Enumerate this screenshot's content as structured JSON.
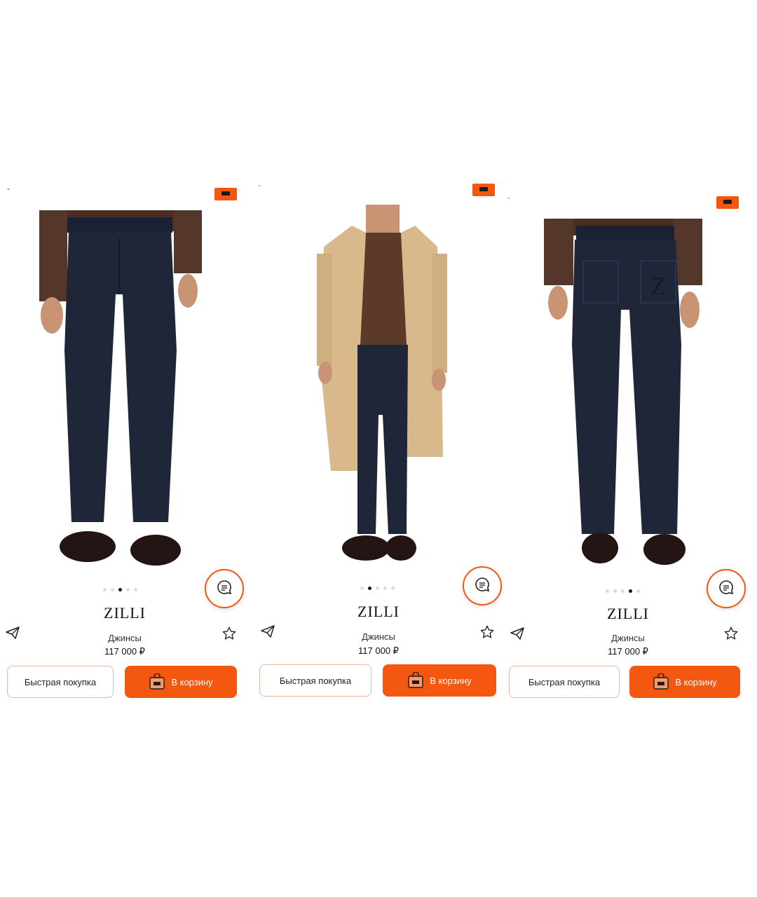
{
  "colors": {
    "accent": "#f4570f",
    "pants": "#1f2638",
    "coat": "#d9b98c",
    "sweater": "#5b3a2a"
  },
  "icons": [
    "chat-icon",
    "share-icon",
    "star-icon",
    "bag-icon"
  ],
  "panels": [
    {
      "brand": "ZILLI",
      "type": "Джинсы",
      "price": "117 000 ₽",
      "quick_label": "Быстрая покупка",
      "cart_label": "В корзину",
      "active_dot": 2,
      "dots_total": 5
    },
    {
      "brand": "ZILLI",
      "type": "Джинсы",
      "price": "117 000 ₽",
      "quick_label": "Быстрая покупка",
      "cart_label": "В корзину",
      "active_dot": 1,
      "dots_total": 5
    },
    {
      "brand": "ZILLI",
      "type": "Джинсы",
      "price": "117 000 ₽",
      "quick_label": "Быстрая покупка",
      "cart_label": "В корзину",
      "active_dot": 3,
      "dots_total": 5
    }
  ]
}
